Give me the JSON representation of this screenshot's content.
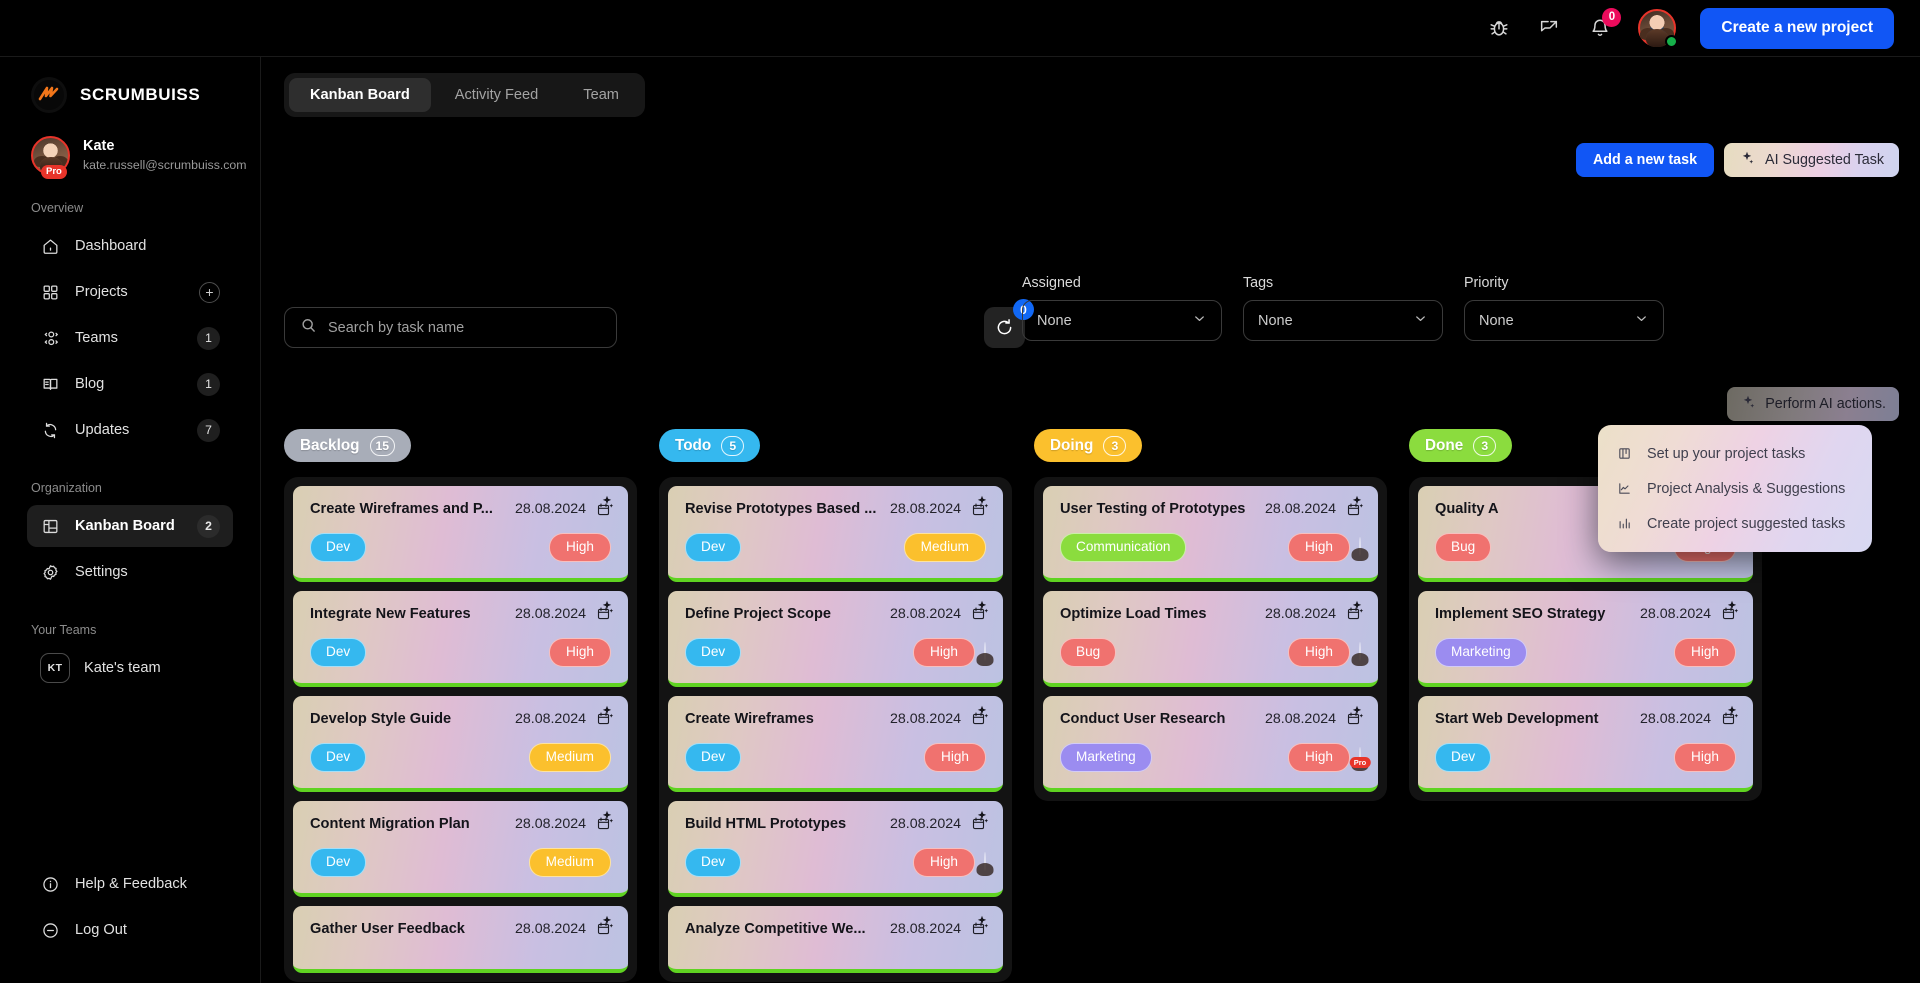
{
  "header": {
    "icons": [
      {
        "name": "bug-icon",
        "label": "Report a bug"
      },
      {
        "name": "share-feedback-icon",
        "label": "Share feedback"
      }
    ],
    "notification_count": "0",
    "create_project_label": "Create a new project"
  },
  "sidebar": {
    "brand": "SCRUMBUISS",
    "user": {
      "name": "Kate",
      "email": "kate.russell@scrumbuiss.com",
      "badge": "Pro"
    },
    "sections": [
      {
        "label": "Overview",
        "items": [
          {
            "label": "Dashboard",
            "icon": "home-icon",
            "badge": "",
            "active": false
          },
          {
            "label": "Projects",
            "icon": "grid-icon",
            "badge": "+",
            "active": false
          },
          {
            "label": "Teams",
            "icon": "users-icon",
            "badge": "1",
            "active": false
          },
          {
            "label": "Blog",
            "icon": "book-icon",
            "badge": "1",
            "active": false
          },
          {
            "label": "Updates",
            "icon": "refresh-icon",
            "badge": "7",
            "active": false
          }
        ]
      },
      {
        "label": "Organization",
        "items": [
          {
            "label": "Kanban Board",
            "icon": "kanban-icon",
            "badge": "2",
            "active": true
          },
          {
            "label": "Settings",
            "icon": "gear-icon",
            "badge": "",
            "active": false
          }
        ]
      }
    ],
    "your_teams_label": "Your Teams",
    "teams": [
      {
        "initials": "KT",
        "name": "Kate's team"
      }
    ],
    "footer": [
      {
        "label": "Help & Feedback",
        "icon": "info-icon"
      },
      {
        "label": "Log Out",
        "icon": "minus-circle-icon"
      }
    ]
  },
  "main": {
    "tabs": [
      {
        "label": "Kanban Board",
        "active": true
      },
      {
        "label": "Activity Feed",
        "active": false
      },
      {
        "label": "Team",
        "active": false
      }
    ],
    "add_task_label": "Add a new task",
    "ai_task_label": "AI Suggested Task",
    "search": {
      "value": "",
      "placeholder": "Search by task name"
    },
    "reset_badge": "0",
    "filters": [
      {
        "label": "Assigned",
        "value": "None"
      },
      {
        "label": "Tags",
        "value": "None"
      },
      {
        "label": "Priority",
        "value": "None"
      }
    ],
    "ai_tooltip": "Perform AI actions.",
    "ai_menu": [
      {
        "label": "Set up your project tasks",
        "icon": "kanban-small-icon"
      },
      {
        "label": "Project Analysis & Suggestions",
        "icon": "line-chart-icon"
      },
      {
        "label": "Create project suggested tasks",
        "icon": "bar-chart-icon"
      }
    ]
  },
  "board": {
    "columns": [
      {
        "title": "Backlog",
        "count": "15",
        "color": "#a8adb8",
        "cards": [
          {
            "title": "Create Wireframes and P...",
            "date": "28.08.2024",
            "tag": "Dev",
            "tag_class": "tag-dev",
            "priority": "High",
            "avatar": ""
          },
          {
            "title": "Integrate New Features",
            "date": "28.08.2024",
            "tag": "Dev",
            "tag_class": "tag-dev",
            "priority": "High",
            "avatar": ""
          },
          {
            "title": "Develop Style Guide",
            "date": "28.08.2024",
            "tag": "Dev",
            "tag_class": "tag-dev",
            "priority": "Medium",
            "avatar": ""
          },
          {
            "title": "Content Migration Plan",
            "date": "28.08.2024",
            "tag": "Dev",
            "tag_class": "tag-dev",
            "priority": "Medium",
            "avatar": ""
          },
          {
            "title": "Gather User Feedback",
            "date": "28.08.2024",
            "tag": "",
            "tag_class": "",
            "priority": "",
            "avatar": ""
          }
        ]
      },
      {
        "title": "Todo",
        "count": "5",
        "color": "#35b8ef",
        "cards": [
          {
            "title": "Revise Prototypes Based ...",
            "date": "28.08.2024",
            "tag": "Dev",
            "tag_class": "tag-dev",
            "priority": "Medium",
            "avatar": ""
          },
          {
            "title": "Define Project Scope",
            "date": "28.08.2024",
            "tag": "Dev",
            "tag_class": "tag-dev",
            "priority": "High",
            "avatar": "av-a"
          },
          {
            "title": "Create Wireframes",
            "date": "28.08.2024",
            "tag": "Dev",
            "tag_class": "tag-dev",
            "priority": "High",
            "avatar": ""
          },
          {
            "title": "Build HTML Prototypes",
            "date": "28.08.2024",
            "tag": "Dev",
            "tag_class": "tag-dev",
            "priority": "High",
            "avatar": "av-b"
          },
          {
            "title": "Analyze Competitive We...",
            "date": "28.08.2024",
            "tag": "",
            "tag_class": "",
            "priority": "",
            "avatar": ""
          }
        ]
      },
      {
        "title": "Doing",
        "count": "3",
        "color": "#fbc02d",
        "cards": [
          {
            "title": "User Testing of Prototypes",
            "date": "28.08.2024",
            "tag": "Communication",
            "tag_class": "tag-communication",
            "priority": "High",
            "avatar": "av-a"
          },
          {
            "title": "Optimize Load Times",
            "date": "28.08.2024",
            "tag": "Bug",
            "tag_class": "tag-bug",
            "priority": "High",
            "avatar": "av-b"
          },
          {
            "title": "Conduct User Research",
            "date": "28.08.2024",
            "tag": "Marketing",
            "tag_class": "tag-marketing",
            "priority": "High",
            "avatar": "av-a",
            "avatar_badge": "Pro"
          }
        ]
      },
      {
        "title": "Done",
        "count": "3",
        "color": "#8bdc3e",
        "cards": [
          {
            "title": "Quality A",
            "date": "",
            "tag": "Bug",
            "tag_class": "tag-bug",
            "priority": "High",
            "avatar": ""
          },
          {
            "title": "Implement SEO Strategy",
            "date": "28.08.2024",
            "tag": "Marketing",
            "tag_class": "tag-marketing",
            "priority": "High",
            "avatar": ""
          },
          {
            "title": "Start Web Development",
            "date": "28.08.2024",
            "tag": "Dev",
            "tag_class": "tag-dev",
            "priority": "High",
            "avatar": ""
          }
        ]
      }
    ]
  }
}
